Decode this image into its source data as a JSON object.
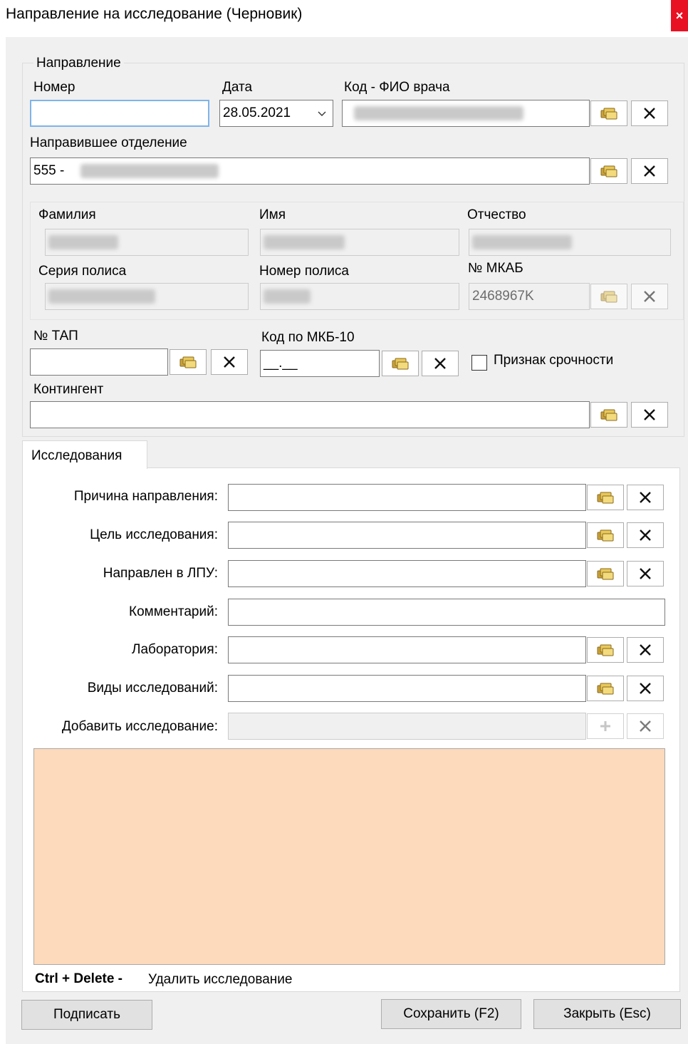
{
  "window": {
    "title": "Направление на исследование (Черновик)",
    "close_glyph": "×"
  },
  "direction": {
    "group_label": "Направление",
    "number_label": "Номер",
    "number_value": "",
    "date_label": "Дата",
    "date_value": "28.05.2021",
    "doctor_label": "Код - ФИО врача",
    "department_label": "Направившее отделение",
    "department_value": "555 -"
  },
  "patient": {
    "surname_label": "Фамилия",
    "name_label": "Имя",
    "patronymic_label": "Отчество",
    "policy_series_label": "Серия полиса",
    "policy_number_label": "Номер полиса",
    "mkab_label": "№ МКАБ",
    "mkab_value": "2468967K"
  },
  "extra": {
    "tap_label": "№ ТАП",
    "tap_value": "",
    "mkb_label": "Код по МКБ-10",
    "mkb_value": "__.__",
    "urgency_label": "Признак срочности",
    "urgency_checked": false,
    "contingent_label": "Контингент",
    "contingent_value": ""
  },
  "tabs": {
    "active": "Исследования"
  },
  "research": {
    "reason_label": "Причина направления:",
    "goal_label": "Цель исследования:",
    "lpu_label": "Направлен в ЛПУ:",
    "comment_label": "Комментарий:",
    "lab_label": "Лаборатория:",
    "types_label": "Виды исследований:",
    "add_label": "Добавить исследование:",
    "hint_keys": "Ctrl + Delete -",
    "hint_text": "Удалить исследование",
    "list_color": "#fcdabb"
  },
  "buttons": {
    "sign": "Подписать",
    "save": "Сохранить (F2)",
    "close": "Закрыть (Esc)"
  },
  "icons": {
    "lookup": "folder-lookup-icon",
    "clear": "clear-x-icon",
    "add": "plus-icon"
  }
}
